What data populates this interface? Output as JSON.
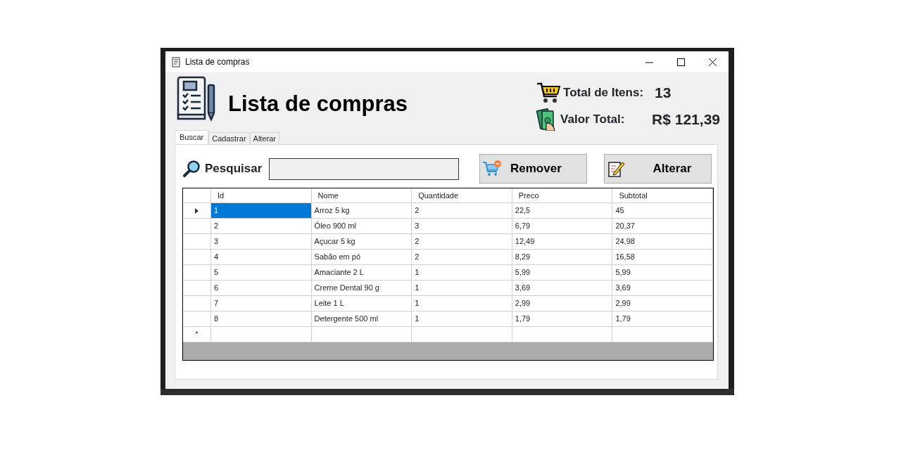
{
  "window": {
    "title": "Lista de compras"
  },
  "header": {
    "title": "Lista de compras",
    "stats": [
      {
        "kind": "cart",
        "label": "Total de Itens:",
        "value": "13"
      },
      {
        "kind": "money",
        "label": "Valor Total:",
        "value": "R$ 121,39"
      }
    ]
  },
  "tabs": [
    {
      "label": "Buscar",
      "selected": true
    },
    {
      "label": "Cadastrar",
      "selected": false
    },
    {
      "label": "Alterar",
      "selected": false
    }
  ],
  "search": {
    "label": "Pesquisar"
  },
  "buttons": [
    {
      "kind": "remove",
      "label": "Remover"
    },
    {
      "kind": "edit",
      "label": "Alterar"
    }
  ],
  "table": {
    "columns": [
      "Id",
      "Nome",
      "Quantidade",
      "Preco",
      "Subtotal"
    ],
    "rows": [
      {
        "current": true,
        "selected": true,
        "cells": [
          "1",
          "Arroz 5 kg",
          "2",
          "22,5",
          "45"
        ]
      },
      {
        "current": false,
        "selected": false,
        "cells": [
          "2",
          "Óleo 900 ml",
          "3",
          "6,79",
          "20,37"
        ]
      },
      {
        "current": false,
        "selected": false,
        "cells": [
          "3",
          "Açucar 5 kg",
          "2",
          "12,49",
          "24,98"
        ]
      },
      {
        "current": false,
        "selected": false,
        "cells": [
          "4",
          "Sabão em pó",
          "2",
          "8,29",
          "16,58"
        ]
      },
      {
        "current": false,
        "selected": false,
        "cells": [
          "5",
          "Amaciante 2 L",
          "1",
          "5,99",
          "5,99"
        ]
      },
      {
        "current": false,
        "selected": false,
        "cells": [
          "6",
          "Creme Dental 90 g",
          "1",
          "3,69",
          "3,69"
        ]
      },
      {
        "current": false,
        "selected": false,
        "cells": [
          "7",
          "Leite 1 L",
          "1",
          "2,99",
          "2,99"
        ]
      },
      {
        "current": false,
        "selected": false,
        "cells": [
          "8",
          "Detergente 500 ml",
          "1",
          "1,79",
          "1,79"
        ]
      }
    ],
    "new_row_marker": "*"
  }
}
